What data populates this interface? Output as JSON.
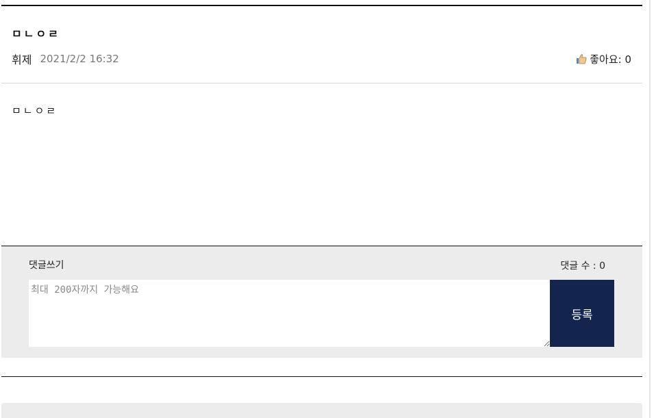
{
  "post": {
    "title": "ㅁㄴㅇㄹ",
    "author": "휘제",
    "date": "2021/2/2 16:32",
    "like_label": "좋아요: 0",
    "body": "ㅁㄴㅇㄹ"
  },
  "comments": {
    "write_label": "댓글쓰기",
    "count_label": "댓글 수 : 0",
    "placeholder": "최대 200자까지 가능해요",
    "submit_label": "등록"
  },
  "icons": {
    "like": "thumbs-up-icon"
  }
}
